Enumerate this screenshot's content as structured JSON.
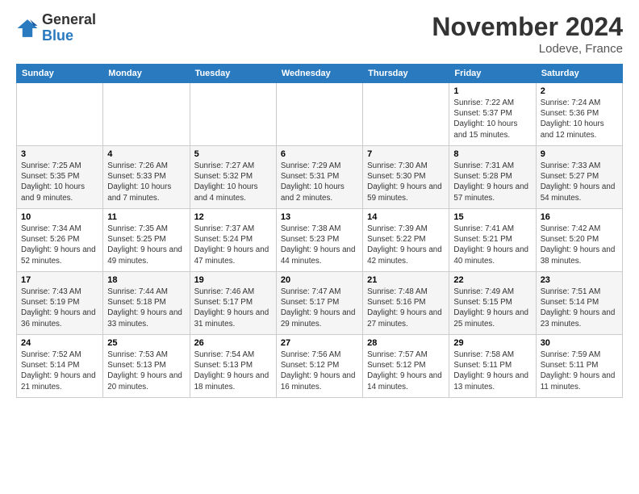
{
  "header": {
    "logo_line1": "General",
    "logo_line2": "Blue",
    "month_title": "November 2024",
    "location": "Lodeve, France"
  },
  "weekdays": [
    "Sunday",
    "Monday",
    "Tuesday",
    "Wednesday",
    "Thursday",
    "Friday",
    "Saturday"
  ],
  "weeks": [
    [
      {
        "day": "",
        "info": ""
      },
      {
        "day": "",
        "info": ""
      },
      {
        "day": "",
        "info": ""
      },
      {
        "day": "",
        "info": ""
      },
      {
        "day": "",
        "info": ""
      },
      {
        "day": "1",
        "info": "Sunrise: 7:22 AM\nSunset: 5:37 PM\nDaylight: 10 hours and 15 minutes."
      },
      {
        "day": "2",
        "info": "Sunrise: 7:24 AM\nSunset: 5:36 PM\nDaylight: 10 hours and 12 minutes."
      }
    ],
    [
      {
        "day": "3",
        "info": "Sunrise: 7:25 AM\nSunset: 5:35 PM\nDaylight: 10 hours and 9 minutes."
      },
      {
        "day": "4",
        "info": "Sunrise: 7:26 AM\nSunset: 5:33 PM\nDaylight: 10 hours and 7 minutes."
      },
      {
        "day": "5",
        "info": "Sunrise: 7:27 AM\nSunset: 5:32 PM\nDaylight: 10 hours and 4 minutes."
      },
      {
        "day": "6",
        "info": "Sunrise: 7:29 AM\nSunset: 5:31 PM\nDaylight: 10 hours and 2 minutes."
      },
      {
        "day": "7",
        "info": "Sunrise: 7:30 AM\nSunset: 5:30 PM\nDaylight: 9 hours and 59 minutes."
      },
      {
        "day": "8",
        "info": "Sunrise: 7:31 AM\nSunset: 5:28 PM\nDaylight: 9 hours and 57 minutes."
      },
      {
        "day": "9",
        "info": "Sunrise: 7:33 AM\nSunset: 5:27 PM\nDaylight: 9 hours and 54 minutes."
      }
    ],
    [
      {
        "day": "10",
        "info": "Sunrise: 7:34 AM\nSunset: 5:26 PM\nDaylight: 9 hours and 52 minutes."
      },
      {
        "day": "11",
        "info": "Sunrise: 7:35 AM\nSunset: 5:25 PM\nDaylight: 9 hours and 49 minutes."
      },
      {
        "day": "12",
        "info": "Sunrise: 7:37 AM\nSunset: 5:24 PM\nDaylight: 9 hours and 47 minutes."
      },
      {
        "day": "13",
        "info": "Sunrise: 7:38 AM\nSunset: 5:23 PM\nDaylight: 9 hours and 44 minutes."
      },
      {
        "day": "14",
        "info": "Sunrise: 7:39 AM\nSunset: 5:22 PM\nDaylight: 9 hours and 42 minutes."
      },
      {
        "day": "15",
        "info": "Sunrise: 7:41 AM\nSunset: 5:21 PM\nDaylight: 9 hours and 40 minutes."
      },
      {
        "day": "16",
        "info": "Sunrise: 7:42 AM\nSunset: 5:20 PM\nDaylight: 9 hours and 38 minutes."
      }
    ],
    [
      {
        "day": "17",
        "info": "Sunrise: 7:43 AM\nSunset: 5:19 PM\nDaylight: 9 hours and 36 minutes."
      },
      {
        "day": "18",
        "info": "Sunrise: 7:44 AM\nSunset: 5:18 PM\nDaylight: 9 hours and 33 minutes."
      },
      {
        "day": "19",
        "info": "Sunrise: 7:46 AM\nSunset: 5:17 PM\nDaylight: 9 hours and 31 minutes."
      },
      {
        "day": "20",
        "info": "Sunrise: 7:47 AM\nSunset: 5:17 PM\nDaylight: 9 hours and 29 minutes."
      },
      {
        "day": "21",
        "info": "Sunrise: 7:48 AM\nSunset: 5:16 PM\nDaylight: 9 hours and 27 minutes."
      },
      {
        "day": "22",
        "info": "Sunrise: 7:49 AM\nSunset: 5:15 PM\nDaylight: 9 hours and 25 minutes."
      },
      {
        "day": "23",
        "info": "Sunrise: 7:51 AM\nSunset: 5:14 PM\nDaylight: 9 hours and 23 minutes."
      }
    ],
    [
      {
        "day": "24",
        "info": "Sunrise: 7:52 AM\nSunset: 5:14 PM\nDaylight: 9 hours and 21 minutes."
      },
      {
        "day": "25",
        "info": "Sunrise: 7:53 AM\nSunset: 5:13 PM\nDaylight: 9 hours and 20 minutes."
      },
      {
        "day": "26",
        "info": "Sunrise: 7:54 AM\nSunset: 5:13 PM\nDaylight: 9 hours and 18 minutes."
      },
      {
        "day": "27",
        "info": "Sunrise: 7:56 AM\nSunset: 5:12 PM\nDaylight: 9 hours and 16 minutes."
      },
      {
        "day": "28",
        "info": "Sunrise: 7:57 AM\nSunset: 5:12 PM\nDaylight: 9 hours and 14 minutes."
      },
      {
        "day": "29",
        "info": "Sunrise: 7:58 AM\nSunset: 5:11 PM\nDaylight: 9 hours and 13 minutes."
      },
      {
        "day": "30",
        "info": "Sunrise: 7:59 AM\nSunset: 5:11 PM\nDaylight: 9 hours and 11 minutes."
      }
    ]
  ]
}
